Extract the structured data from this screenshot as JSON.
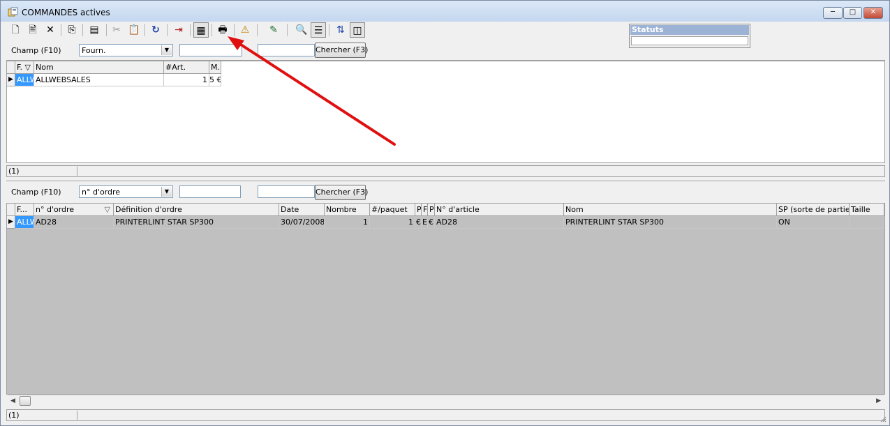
{
  "window": {
    "title": "COMMANDES actives"
  },
  "title_buttons": {
    "minimize": "─",
    "maximize": "□",
    "close": "✕"
  },
  "toolbar": {
    "icons": [
      {
        "name": "new-document-icon",
        "glyph": "🗋"
      },
      {
        "name": "edit-record-icon",
        "glyph": "🖹"
      },
      {
        "name": "delete-icon",
        "glyph": "✕"
      },
      {
        "name": "copy-icon",
        "glyph": "⎘"
      },
      {
        "name": "properties-icon",
        "glyph": "▤"
      },
      {
        "name": "scissors-icon",
        "glyph": "✂"
      },
      {
        "name": "clipboard-icon",
        "glyph": "📋"
      },
      {
        "name": "refresh-icon",
        "glyph": "↻"
      },
      {
        "name": "import-icon",
        "glyph": "⇥"
      },
      {
        "name": "calendar-view-icon",
        "glyph": "▦"
      },
      {
        "name": "print-icon",
        "glyph": "🖶"
      },
      {
        "name": "alert-user-icon",
        "glyph": "⚠"
      },
      {
        "name": "marker-icon",
        "glyph": "✎"
      },
      {
        "name": "search-icon",
        "glyph": "🔍"
      },
      {
        "name": "list-view-icon",
        "glyph": "☰"
      },
      {
        "name": "sort-az-icon",
        "glyph": "⇅"
      },
      {
        "name": "columns-icon",
        "glyph": "◫"
      }
    ]
  },
  "top_filter": {
    "field_label": "Champ (F10)",
    "field_value": "Fourn.",
    "search_value": "",
    "search2_value": "",
    "search_button": "Chercher (F3)"
  },
  "statuts": {
    "title": "Statuts",
    "value": ""
  },
  "top_grid": {
    "columns": [
      "F. ▽",
      "Nom",
      "#Art.",
      "M."
    ],
    "rows": [
      {
        "code": "ALLW",
        "nom": "ALLWEBSALES",
        "art": "1",
        "m": "5 €"
      }
    ]
  },
  "top_status": {
    "count": "(1)"
  },
  "bottom_filter": {
    "field_label": "Champ (F10)",
    "field_value": "n° d'ordre",
    "search_value": "",
    "search2_value": "",
    "search_button": "Chercher (F3)"
  },
  "bottom_grid": {
    "columns": [
      "F...",
      "n° d'ordre",
      "Définition d'ordre",
      "Date",
      "Nombre",
      "#/paquet",
      "P",
      "F",
      "P",
      "N° d'article",
      "Nom",
      "SP (sorte de partie)",
      "Taille"
    ],
    "sort_marker": "▽",
    "rows": [
      {
        "code": "ALLW",
        "ordre": "AD28",
        "definition": "PRINTERLINT STAR SP300",
        "date": "30/07/2008",
        "nombre": "1",
        "paquet": "1",
        "p1": "€",
        "f": "E",
        "p2": "€",
        "article": "AD28",
        "nom": "PRINTERLINT STAR SP300",
        "sp": "ON",
        "taille": ""
      }
    ]
  },
  "bottom_status": {
    "count": "(1)"
  },
  "colors": {
    "annotation_arrow": "#e01010",
    "selection": "#3399ff",
    "statuts_header": "#9db3d6"
  }
}
